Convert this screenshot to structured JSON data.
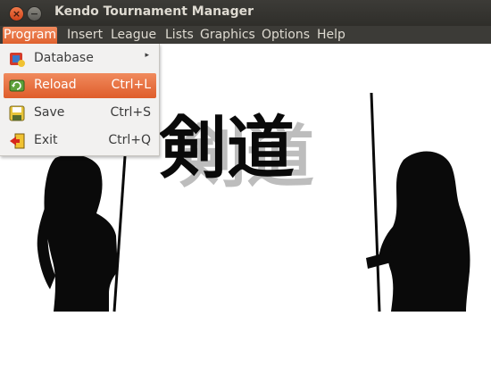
{
  "window": {
    "title": "Kendo Tournament Manager",
    "close_glyph": "×",
    "minimize_glyph": "−"
  },
  "menubar": {
    "items": [
      {
        "label": "Program",
        "active": true
      },
      {
        "label": "Insert"
      },
      {
        "label": "League"
      },
      {
        "label": "Lists"
      },
      {
        "label": "Graphics"
      },
      {
        "label": "Options"
      },
      {
        "label": "Help"
      }
    ]
  },
  "program_menu": {
    "items": [
      {
        "label": "Database",
        "icon": "database-icon",
        "submenu_arrow": "▸"
      },
      {
        "label": "Reload",
        "shortcut": "Ctrl+L",
        "icon": "reload-icon",
        "highlighted": true
      },
      {
        "label": "Save",
        "shortcut": "Ctrl+S",
        "icon": "save-icon"
      },
      {
        "label": "Exit",
        "shortcut": "Ctrl+Q",
        "icon": "exit-icon"
      }
    ]
  },
  "background": {
    "calligraphy": "剣道",
    "left_figure": "kendoka-silhouette-left",
    "right_figure": "kendoka-silhouette-right"
  },
  "colors": {
    "titlebar": "#3c3b37",
    "menu_highlight": "#e96a3a",
    "menu_bg": "#f2f1f0",
    "silhouette": "#0a0a0a"
  }
}
